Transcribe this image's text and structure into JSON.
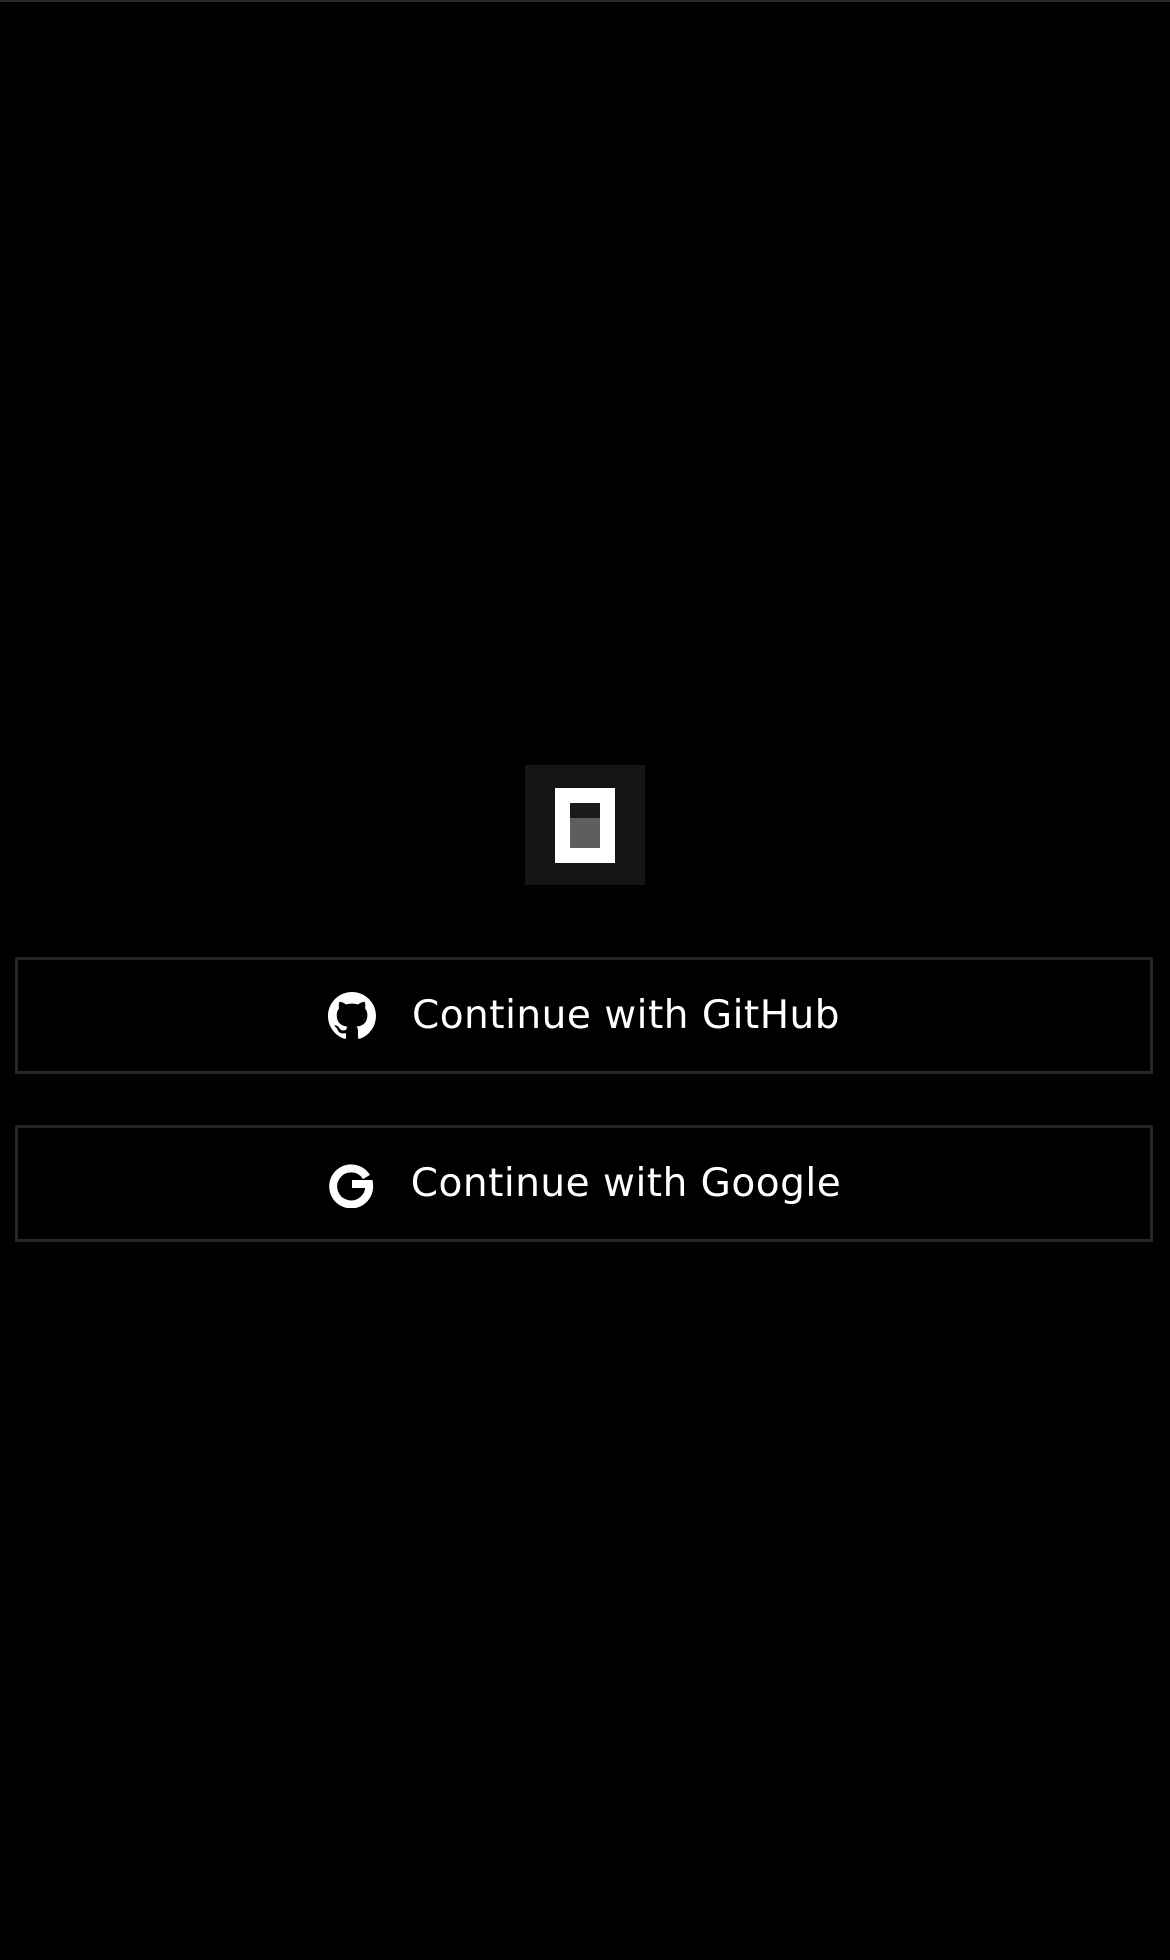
{
  "app": {
    "logo_name": "app-logo"
  },
  "auth": {
    "github": {
      "label": "Continue with GitHub",
      "icon": "github-icon"
    },
    "google": {
      "label": "Continue with Google",
      "icon": "google-icon"
    }
  },
  "colors": {
    "background": "#000000",
    "button_border": "#262626",
    "logo_bg": "#141414",
    "text": "#ffffff"
  }
}
